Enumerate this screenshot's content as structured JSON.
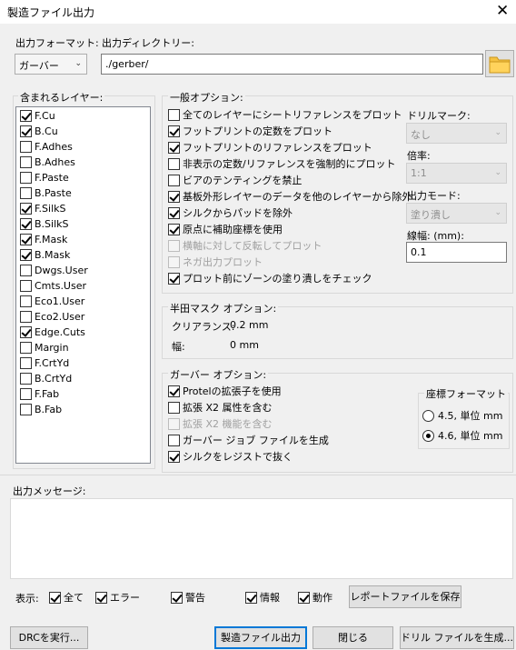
{
  "window": {
    "title": "製造ファイル出力",
    "close_glyph": "✕"
  },
  "format": {
    "label": "出力フォーマット:",
    "value": "ガーバー"
  },
  "output_dir": {
    "label": "出力ディレクトリー:",
    "value": "./gerber/"
  },
  "layers": {
    "label": "含まれるレイヤー:",
    "items": [
      {
        "name": "F.Cu",
        "checked": true
      },
      {
        "name": "B.Cu",
        "checked": true
      },
      {
        "name": "F.Adhes",
        "checked": false
      },
      {
        "name": "B.Adhes",
        "checked": false
      },
      {
        "name": "F.Paste",
        "checked": false
      },
      {
        "name": "B.Paste",
        "checked": false
      },
      {
        "name": "F.SilkS",
        "checked": true
      },
      {
        "name": "B.SilkS",
        "checked": true
      },
      {
        "name": "F.Mask",
        "checked": true
      },
      {
        "name": "B.Mask",
        "checked": true
      },
      {
        "name": "Dwgs.User",
        "checked": false
      },
      {
        "name": "Cmts.User",
        "checked": false
      },
      {
        "name": "Eco1.User",
        "checked": false
      },
      {
        "name": "Eco2.User",
        "checked": false
      },
      {
        "name": "Edge.Cuts",
        "checked": true
      },
      {
        "name": "Margin",
        "checked": false
      },
      {
        "name": "F.CrtYd",
        "checked": false
      },
      {
        "name": "B.CrtYd",
        "checked": false
      },
      {
        "name": "F.Fab",
        "checked": false
      },
      {
        "name": "B.Fab",
        "checked": false
      }
    ]
  },
  "general": {
    "label": "一般オプション:",
    "options": [
      {
        "label": "全てのレイヤーにシートリファレンスをプロット",
        "checked": false,
        "disabled": false
      },
      {
        "label": "フットプリントの定数をプロット",
        "checked": true,
        "disabled": false
      },
      {
        "label": "フットプリントのリファレンスをプロット",
        "checked": true,
        "disabled": false
      },
      {
        "label": "非表示の定数/リファレンスを強制的にプロット",
        "checked": false,
        "disabled": false
      },
      {
        "label": "ビアのテンティングを禁止",
        "checked": false,
        "disabled": false
      },
      {
        "label": "基板外形レイヤーのデータを他のレイヤーから除外",
        "checked": true,
        "disabled": false
      },
      {
        "label": "シルクからパッドを除外",
        "checked": true,
        "disabled": false
      },
      {
        "label": "原点に補助座標を使用",
        "checked": true,
        "disabled": false
      },
      {
        "label": "横軸に対して反転してプロット",
        "checked": false,
        "disabled": true
      },
      {
        "label": "ネガ出力プロット",
        "checked": false,
        "disabled": true
      },
      {
        "label": "プロット前にゾーンの塗り潰しをチェック",
        "checked": true,
        "disabled": false
      }
    ],
    "drill_mark": {
      "label": "ドリルマーク:",
      "value": "なし"
    },
    "scale": {
      "label": "倍率:",
      "value": "1:1"
    },
    "output_mode": {
      "label": "出力モード:",
      "value": "塗り潰し"
    },
    "line_width": {
      "label": "線幅: (mm):",
      "value": "0.1"
    }
  },
  "solder_mask": {
    "label": "半田マスク オプション:",
    "clearance_label": "クリアランス:",
    "clearance_value": "0.2 mm",
    "width_label": "幅:",
    "width_value": "0 mm"
  },
  "gerber": {
    "label": "ガーバー オプション:",
    "options": [
      {
        "label": "Protelの拡張子を使用",
        "checked": true,
        "disabled": false
      },
      {
        "label": "拡張 X2 属性を含む",
        "checked": false,
        "disabled": false
      },
      {
        "label": "拡張 X2 機能を含む",
        "checked": false,
        "disabled": true
      },
      {
        "label": "ガーバー ジョブ ファイルを生成",
        "checked": false,
        "disabled": false
      },
      {
        "label": "シルクをレジストで抜く",
        "checked": true,
        "disabled": false
      }
    ],
    "coord_format": {
      "label": "座標フォーマット",
      "options": [
        {
          "label": "4.5, 単位 mm",
          "selected": false
        },
        {
          "label": "4.6, 単位 mm",
          "selected": true
        }
      ]
    }
  },
  "messages": {
    "label": "出力メッセージ:"
  },
  "filters": {
    "label": "表示:",
    "items": [
      {
        "label": "全て",
        "checked": true
      },
      {
        "label": "エラー",
        "checked": true
      },
      {
        "label": "警告",
        "checked": true
      },
      {
        "label": "情報",
        "checked": true
      },
      {
        "label": "動作",
        "checked": true
      }
    ],
    "save_report": "レポートファイルを保存"
  },
  "buttons": {
    "run_drc": "DRCを実行...",
    "plot": "製造ファイル出力",
    "close": "閉じる",
    "gen_drill": "ドリル ファイルを生成..."
  }
}
